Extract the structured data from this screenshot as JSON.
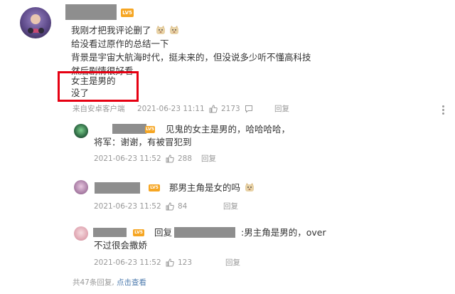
{
  "main_comment": {
    "level_badge": "LV5",
    "lines": [
      "我刚才把我评论删了",
      "给没看过原作的总结一下",
      "背景是宇宙大航海时代，挺未来的，但没说多少听不懂高科技",
      "然后剧情很好看",
      "女主是男的",
      "没了"
    ],
    "source": "来自安卓客户端",
    "timestamp": "2021-06-23 11:11",
    "likes": "2173",
    "comment_label": "评论",
    "reply_label": "回复"
  },
  "replies": [
    {
      "level_badge": "LV5",
      "lines": [
        "见鬼的女主是男的，哈哈哈哈，",
        "将军：谢谢，有被冒犯到"
      ],
      "timestamp": "2021-06-23 11:52",
      "likes": "288",
      "reply_label": "回复"
    },
    {
      "level_badge": "LV5",
      "lines": [
        "那男主角是女的吗"
      ],
      "timestamp": "2021-06-23 11:52",
      "likes": "84",
      "reply_label": "回复"
    },
    {
      "level_badge": "LV5",
      "prefix": "回复",
      "text_after_name": ":男主角是男的，over",
      "line2": "不过很会撒娇",
      "timestamp": "2021-06-23 11:52",
      "likes": "123",
      "reply_label": "回复"
    }
  ],
  "footer": {
    "total_replies": "共47条回复,",
    "view_link": "点击查看"
  },
  "colors": {
    "highlight_border": "#e60012",
    "link": "#507daf",
    "badge": "#f6a623",
    "meta": "#999999"
  }
}
